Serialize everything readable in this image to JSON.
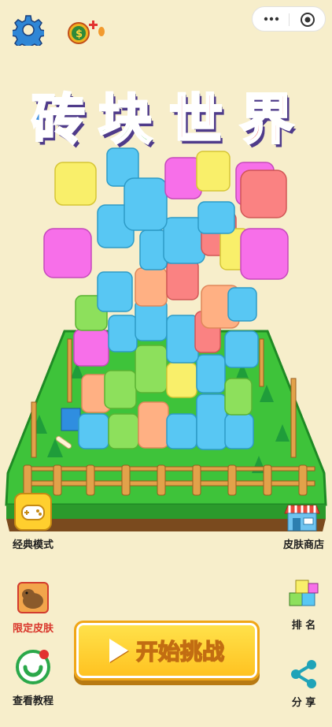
{
  "title": {
    "chars": [
      "砖",
      "块",
      "世",
      "界"
    ],
    "colors": [
      "#3b8fe0",
      "#3cc23a",
      "#e23230",
      "#e93a2f"
    ]
  },
  "buttons": {
    "classic_mode": "经典模式",
    "skin_shop": "皮肤商店",
    "limited_skin": "限定皮肤",
    "tutorial": "查看教程",
    "rank": "排 名",
    "share": "分 享",
    "start": "开始挑战"
  },
  "icons": {
    "settings": "gear-icon",
    "coin_bonus": "coin-bonus-icon",
    "more": "more-dots-icon",
    "close": "close-circle-icon"
  },
  "colors": {
    "accent": "#ffc11f",
    "grass": "#3ec33a",
    "background": "#f7eecb"
  }
}
